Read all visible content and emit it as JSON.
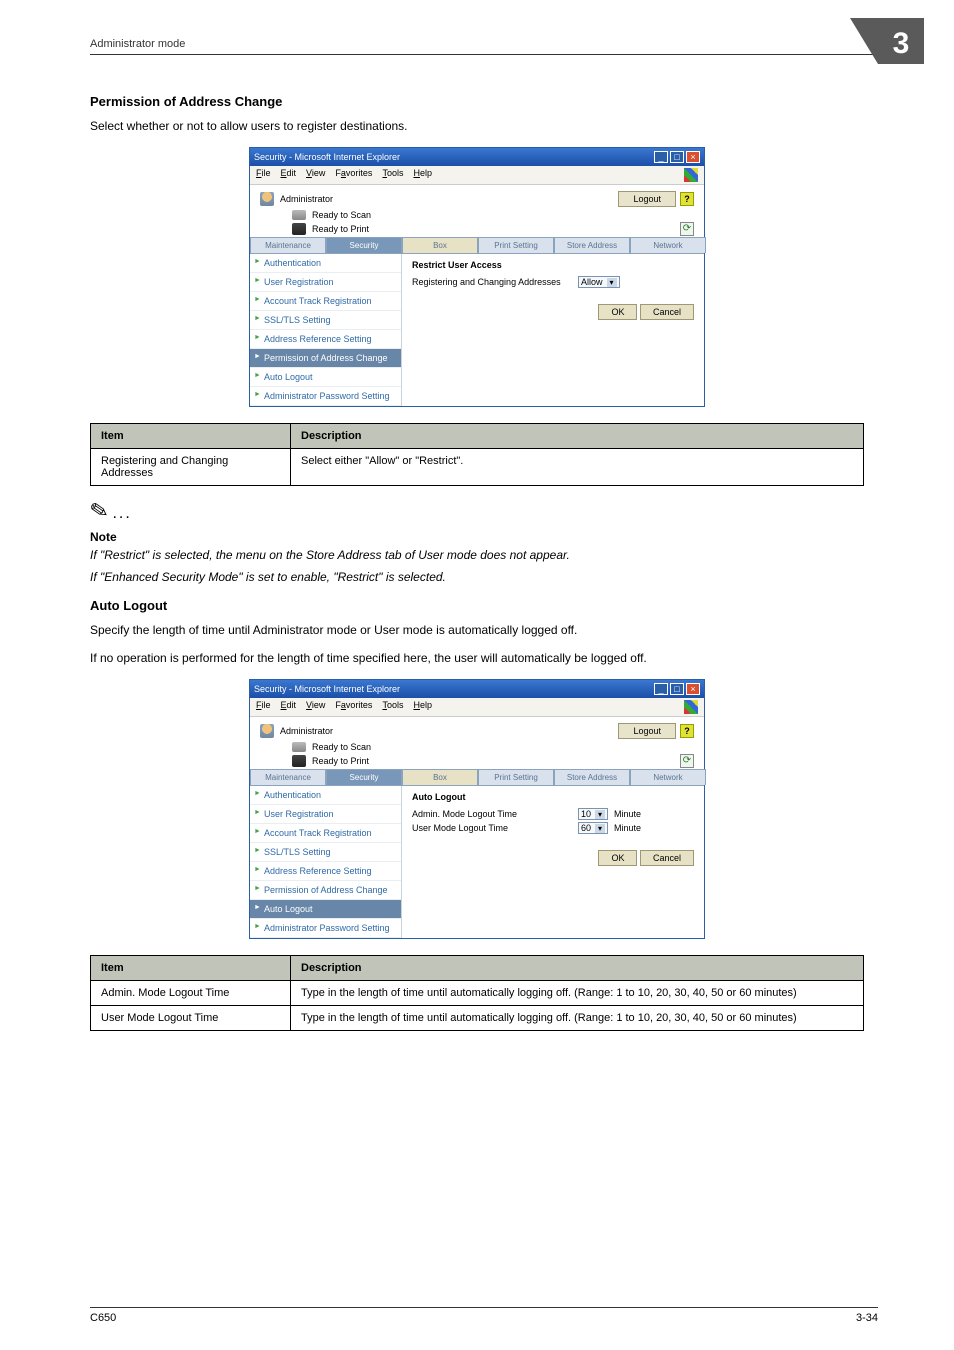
{
  "doc": {
    "headerTitle": "Administrator mode",
    "chapterNum": "3",
    "footerLeft": "C650",
    "footerRight": "3-34"
  },
  "section1": {
    "heading": "Permission of Address Change",
    "intro": "Select whether or not to allow users to register destinations."
  },
  "ieCommon": {
    "title": "Security - Microsoft Internet Explorer",
    "menu": {
      "file": "File",
      "edit": "Edit",
      "view": "View",
      "favorites": "Favorites",
      "tools": "Tools",
      "help": "Help"
    },
    "adminLabel": "Administrator",
    "logout": "Logout",
    "readyScan": "Ready to Scan",
    "readyPrint": "Ready to Print",
    "tabs": {
      "maintenance": "Maintenance",
      "security": "Security",
      "box": "Box",
      "print": "Print Setting",
      "store": "Store Address",
      "network": "Network"
    },
    "side": {
      "auth": "Authentication",
      "userReg": "User Registration",
      "acct": "Account Track Registration",
      "ssl": "SSL/TLS Setting",
      "addrRef": "Address Reference Setting",
      "permAddr": "Permission of Address Change",
      "autoLogout": "Auto Logout",
      "adminPw": "Administrator Password Setting"
    },
    "ok": "OK",
    "cancel": "Cancel"
  },
  "ie1": {
    "mainTitle": "Restrict User Access",
    "fieldLabel": "Registering and Changing Addresses",
    "fieldValue": "Allow"
  },
  "table1": {
    "h1": "Item",
    "h2": "Description",
    "r1c1": "Registering and Changing Addresses",
    "r1c2": "Select either \"Allow\" or \"Restrict\"."
  },
  "note": {
    "dots": "...",
    "label": "Note",
    "p1": "If \"Restrict\" is selected, the menu on the Store Address tab of User mode does not appear.",
    "p2": "If \"Enhanced Security Mode\" is set to enable, \"Restrict\" is selected."
  },
  "section2": {
    "heading": "Auto Logout",
    "p1": "Specify the length of time until Administrator mode or User mode is automatically logged off.",
    "p2": "If no operation is performed for the length of time specified here, the user will automatically be logged off."
  },
  "ie2": {
    "mainTitle": "Auto Logout",
    "f1Label": "Admin. Mode Logout Time",
    "f1Val": "10",
    "unit": "Minute",
    "f2Label": "User Mode Logout Time",
    "f2Val": "60"
  },
  "table2": {
    "h1": "Item",
    "h2": "Description",
    "r1c1": "Admin. Mode Logout Time",
    "r1c2": "Type in the length of time until automatically logging off. (Range: 1 to 10, 20, 30, 40, 50 or 60 minutes)",
    "r2c1": "User Mode Logout Time",
    "r2c2": "Type in the length of time until automatically logging off. (Range: 1 to 10, 20, 30, 40, 50 or 60 minutes)"
  }
}
